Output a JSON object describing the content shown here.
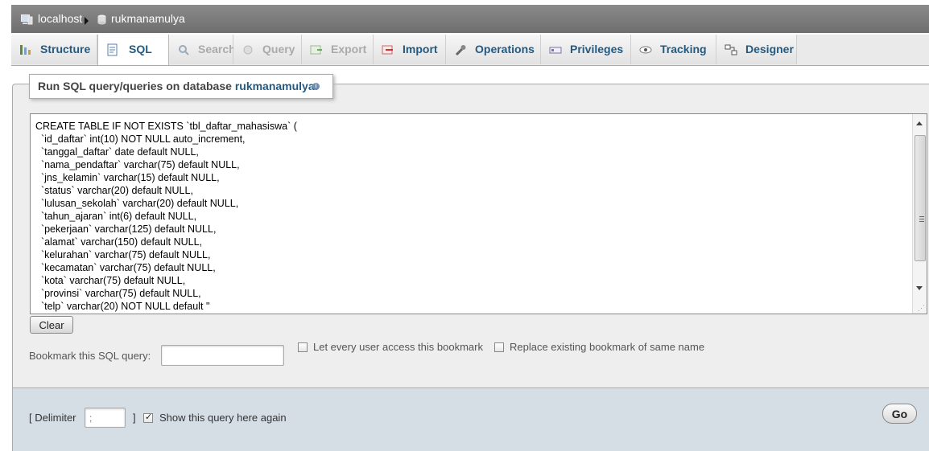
{
  "breadcrumb": {
    "server": "localhost",
    "database": "rukmanamulya"
  },
  "tabs": [
    {
      "label": "Structure",
      "icon": "structure-icon",
      "state": "normal"
    },
    {
      "label": "SQL",
      "icon": "sql-icon",
      "state": "active"
    },
    {
      "label": "Search",
      "icon": "search-icon",
      "state": "disabled"
    },
    {
      "label": "Query",
      "icon": "query-icon",
      "state": "disabled"
    },
    {
      "label": "Export",
      "icon": "export-icon",
      "state": "disabled"
    },
    {
      "label": "Import",
      "icon": "import-icon",
      "state": "normal"
    },
    {
      "label": "Operations",
      "icon": "wrench-icon",
      "state": "normal"
    },
    {
      "label": "Privileges",
      "icon": "privileges-icon",
      "state": "normal"
    },
    {
      "label": "Tracking",
      "icon": "eye-icon",
      "state": "normal"
    },
    {
      "label": "Designer",
      "icon": "designer-icon",
      "state": "normal"
    }
  ],
  "query_panel": {
    "legend_prefix": "Run SQL query/queries on database",
    "legend_db": "rukmanamulya:",
    "sql_lines": [
      "CREATE TABLE IF NOT EXISTS `tbl_daftar_mahasiswa` (",
      "  `id_daftar` int(10) NOT NULL auto_increment,",
      "  `tanggal_daftar` date default NULL,",
      "  `nama_pendaftar` varchar(75) default NULL,",
      "  `jns_kelamin` varchar(15) default NULL,",
      "  `status` varchar(20) default NULL,",
      "  `lulusan_sekolah` varchar(20) default NULL,",
      "  `tahun_ajaran` int(6) default NULL,",
      "  `pekerjaan` varchar(125) default NULL,",
      "  `alamat` varchar(150) default NULL,",
      "  `kelurahan` varchar(75) default NULL,",
      "  `kecamatan` varchar(75) default NULL,",
      "  `kota` varchar(75) default NULL,",
      "  `provinsi` varchar(75) default NULL,",
      "  `telp` varchar(20) NOT NULL default ''"
    ],
    "clear_label": "Clear",
    "bookmark_label": "Bookmark this SQL query:",
    "bookmark_value": "",
    "every_user_label": "Let every user access this bookmark",
    "replace_label": "Replace existing bookmark of same name"
  },
  "footer": {
    "delimiter_open": "[ Delimiter",
    "delimiter_value": ";",
    "delimiter_close": "]",
    "show_again_label": "Show this query here again",
    "show_again_checked": true,
    "go_label": "Go"
  }
}
